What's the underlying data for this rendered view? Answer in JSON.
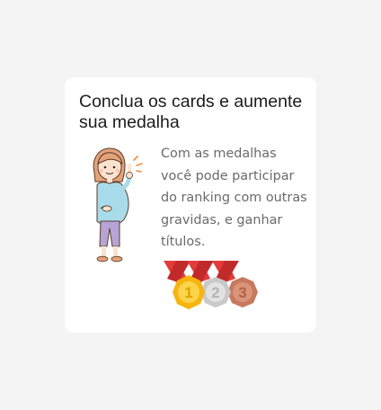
{
  "card": {
    "title": "Conclua os cards e aumente sua medalha",
    "description": "Com as medalhas você pode participar do ranking com outras gravidas, e ganhar títulos.",
    "illustration_icon": "pregnant-woman-icon"
  },
  "medals": [
    {
      "rank": "1",
      "tier": "gold",
      "color": "#f6b40e",
      "icon": "gold-medal-icon"
    },
    {
      "rank": "2",
      "tier": "silver",
      "color": "#c9c9c9",
      "icon": "silver-medal-icon"
    },
    {
      "rank": "3",
      "tier": "bronze",
      "color": "#c7795e",
      "icon": "bronze-medal-icon"
    }
  ],
  "colors": {
    "background": "#f4f4f4",
    "card": "#ffffff",
    "ribbon": "#e23b3b"
  }
}
